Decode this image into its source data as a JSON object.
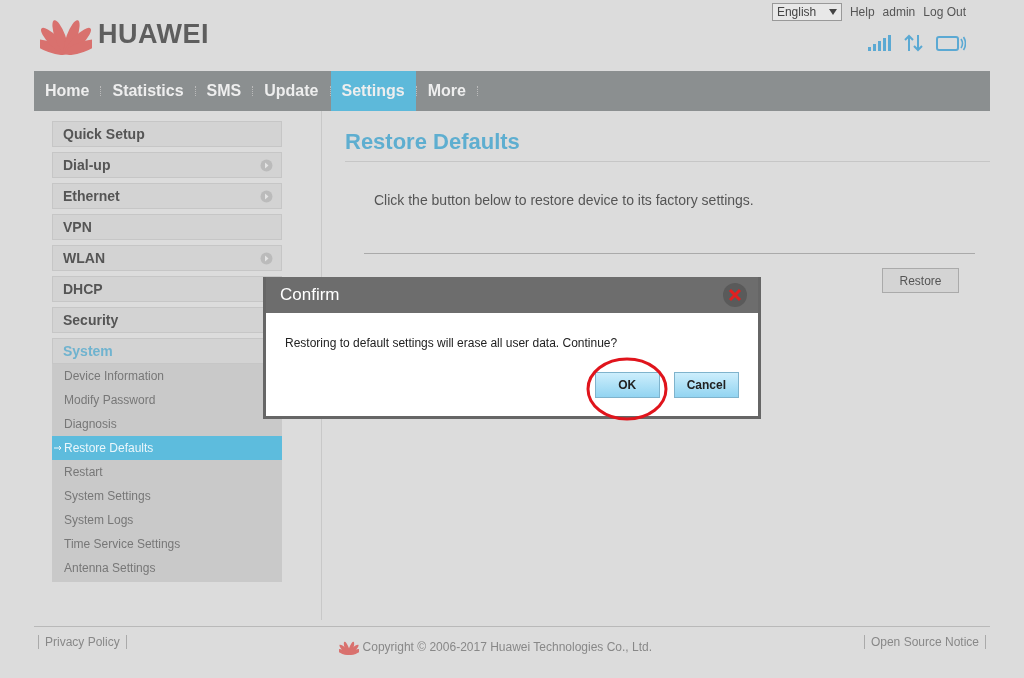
{
  "header": {
    "brand": "HUAWEI",
    "language": "English",
    "links": [
      "Help",
      "admin",
      "Log Out"
    ]
  },
  "nav": [
    {
      "label": "Home",
      "selected": false
    },
    {
      "label": "Statistics",
      "selected": false
    },
    {
      "label": "SMS",
      "selected": false
    },
    {
      "label": "Update",
      "selected": false
    },
    {
      "label": "Settings",
      "selected": true
    },
    {
      "label": "More",
      "selected": false
    }
  ],
  "sidebar": [
    {
      "label": "Quick Setup",
      "has_submenu": false
    },
    {
      "label": "Dial-up",
      "has_submenu": true
    },
    {
      "label": "Ethernet",
      "has_submenu": true
    },
    {
      "label": "VPN",
      "has_submenu": false
    },
    {
      "label": "WLAN",
      "has_submenu": true
    },
    {
      "label": "DHCP",
      "has_submenu": false
    },
    {
      "label": "Security",
      "has_submenu": false
    },
    {
      "label": "System",
      "has_submenu": false,
      "expanded": true,
      "children": [
        {
          "label": "Device Information",
          "selected": false
        },
        {
          "label": "Modify Password",
          "selected": false
        },
        {
          "label": "Diagnosis",
          "selected": false
        },
        {
          "label": "Restore Defaults",
          "selected": true
        },
        {
          "label": "Restart",
          "selected": false
        },
        {
          "label": "System Settings",
          "selected": false
        },
        {
          "label": "System Logs",
          "selected": false
        },
        {
          "label": "Time Service Settings",
          "selected": false
        },
        {
          "label": "Antenna Settings",
          "selected": false
        }
      ]
    }
  ],
  "content": {
    "title": "Restore Defaults",
    "description": "Click the button below to restore device to its factory settings.",
    "button": "Restore"
  },
  "dialog": {
    "title": "Confirm",
    "message": "Restoring to default settings will erase all user data. Continue?",
    "buttons": [
      {
        "label": "OK",
        "circled": true
      },
      {
        "label": "Cancel",
        "circled": false
      }
    ]
  },
  "footer": {
    "left": "Privacy Policy",
    "center": "Copyright © 2006-2017 Huawei Technologies Co., Ltd.",
    "right": "Open Source Notice"
  }
}
